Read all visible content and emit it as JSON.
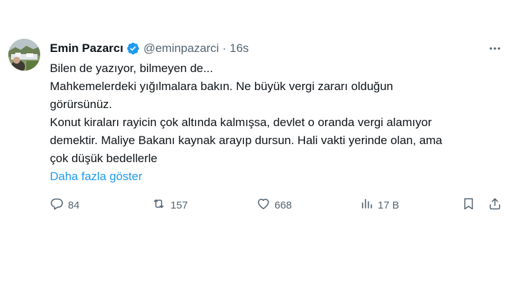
{
  "author": {
    "name": "Emin Pazarcı",
    "handle": "@eminpazarci",
    "separator": "·",
    "time": "16s"
  },
  "tweet": {
    "lines": [
      "Bilen de yazıyor, bilmeyen de...",
      "Mahkemelerdeki yığılmalara bakın. Ne büyük vergi zararı olduğun",
      "görürsünüz.",
      "Konut kiraları rayicin çok altında kalmışsa, devlet o oranda vergi alamıyor",
      "demektir. Maliye Bakanı kaynak arayıp dursun. Hali vakti yerinde olan, ama",
      "çok düşük bedellerle"
    ],
    "show_more": "Daha fazla göster"
  },
  "actions": {
    "replies": "84",
    "retweets": "157",
    "likes": "668",
    "views": "17 B"
  },
  "icons": {
    "verified": "verified-badge-icon",
    "more": "more-icon",
    "reply": "reply-icon",
    "retweet": "retweet-icon",
    "like": "heart-icon",
    "views": "views-icon",
    "bookmark": "bookmark-icon",
    "share": "share-icon"
  },
  "colors": {
    "text": "#0f1419",
    "secondary": "#536471",
    "accent": "#1d9bf0"
  }
}
